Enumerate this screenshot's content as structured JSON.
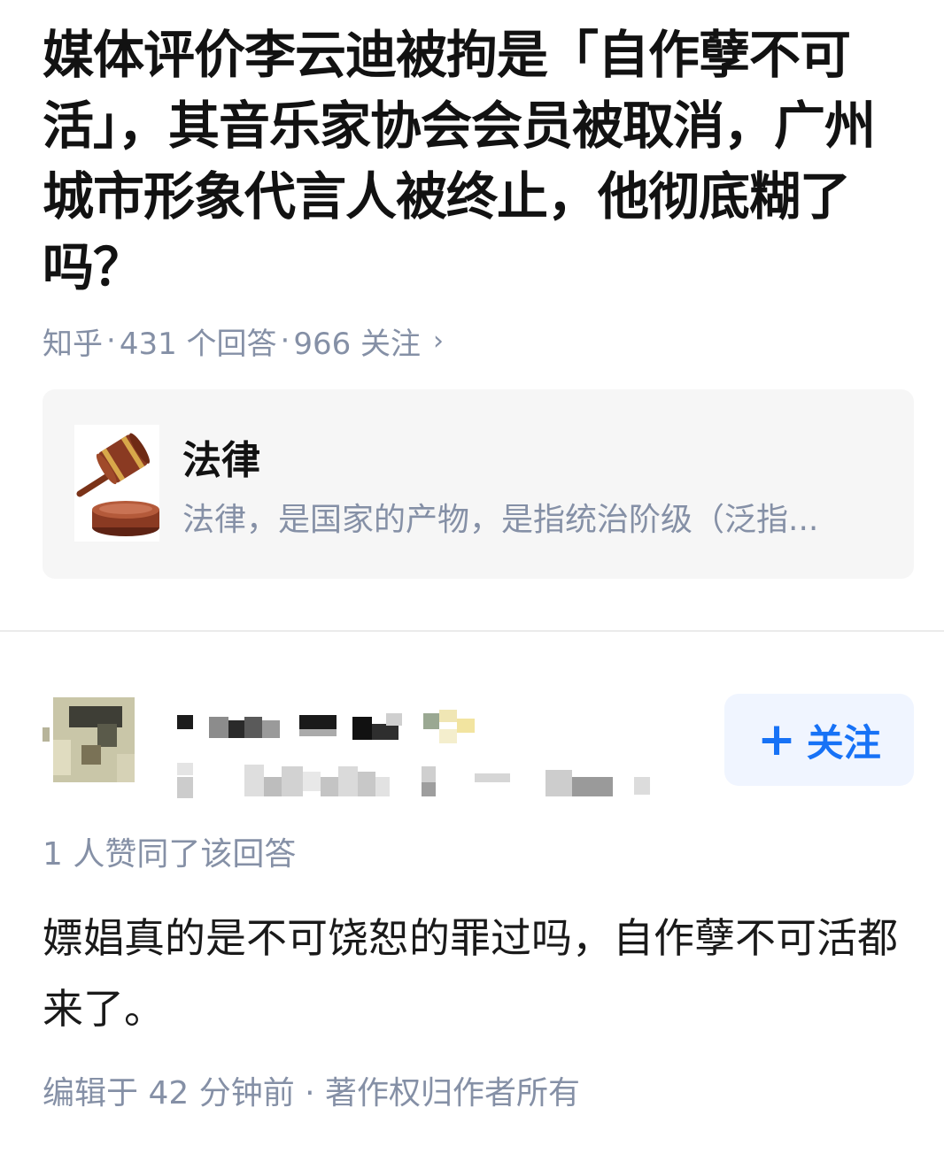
{
  "question": {
    "title": "媒体评价李云迪被拘是「自作孽不可活」，其音乐家协会会员被取消，广州城市形象代言人被终止，他彻底糊了吗？",
    "source": "知乎",
    "separator": "·",
    "answer_count": "431 个回答",
    "follower_count": "966 关注",
    "chevron": "›"
  },
  "topic": {
    "icon": "gavel-icon",
    "name": "法律",
    "description": "法律，是国家的产物，是指统治阶级（泛指..."
  },
  "answer": {
    "follow_button": {
      "label": "关注",
      "icon": "+"
    },
    "vote_summary": "1 人赞同了该回答",
    "content": "嫖娼真的是不可饶恕的罪过吗，自作孽不可活都来了。",
    "footer": "编辑于 42 分钟前 · 著作权归作者所有"
  },
  "colors": {
    "accent": "#1772f6",
    "muted_text": "#8590a6",
    "card_background": "#f6f6f6",
    "follow_background": "#f0f5ff"
  }
}
